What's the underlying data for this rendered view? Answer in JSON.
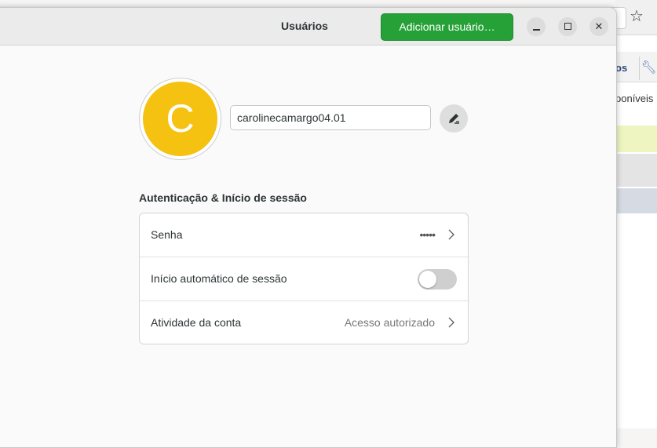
{
  "window": {
    "title": "Usuários",
    "add_user_label": "Adicionar usuário…"
  },
  "user": {
    "avatar_initial": "C",
    "avatar_color": "#f5c211",
    "username": "carolinecamargo04.01"
  },
  "auth": {
    "section_title": "Autenticação & Início de sessão",
    "password": {
      "label": "Senha",
      "value": "•••••"
    },
    "autologin": {
      "label": "Início automático de sessão",
      "enabled": false
    },
    "activity": {
      "label": "Atividade da conta",
      "value": "Acesso autorizado"
    }
  },
  "background": {
    "tab1_fragment": "os",
    "tagline_fragment": "poníveis"
  },
  "colors": {
    "accent_green": "#26a137",
    "avatar_yellow": "#f5c211"
  }
}
